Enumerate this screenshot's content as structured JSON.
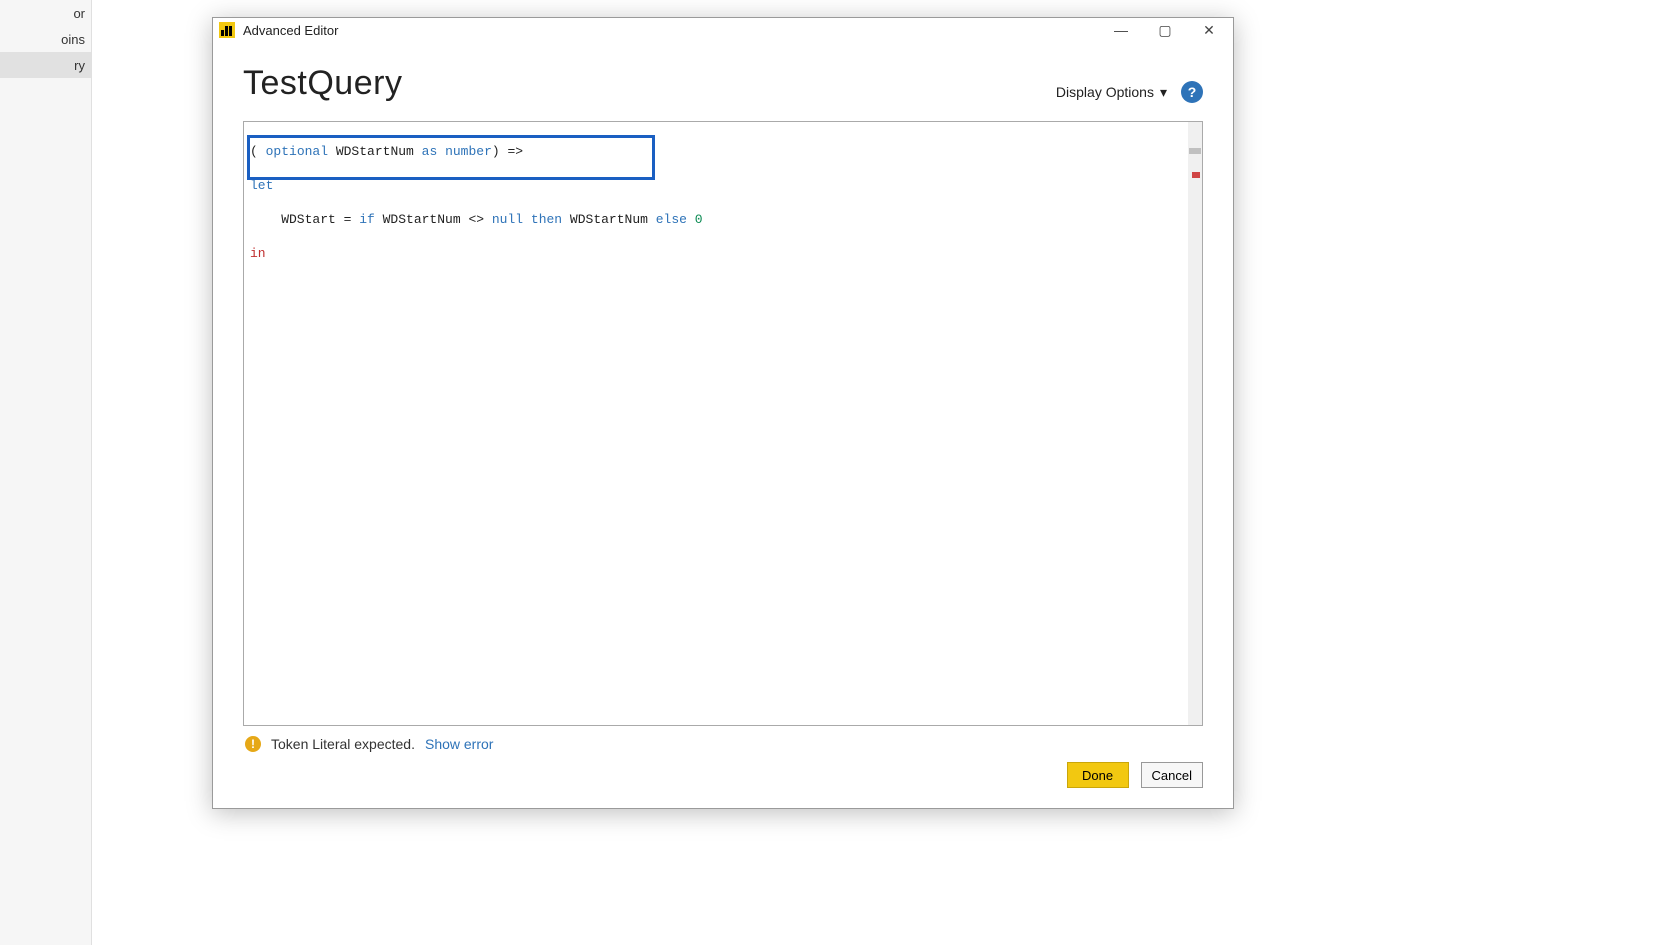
{
  "sidebar": {
    "items": [
      {
        "label": "or"
      },
      {
        "label": "oins"
      },
      {
        "label": "ry"
      }
    ],
    "selected_index": 2
  },
  "window": {
    "title": "Advanced Editor"
  },
  "page": {
    "query_name": "TestQuery",
    "display_options_label": "Display Options"
  },
  "code": {
    "line1_pre": "( ",
    "line1_kw1": "optional",
    "line1_mid": " WDStartNum ",
    "line1_kw2": "as",
    "line1_sp": " ",
    "line1_kw3": "number",
    "line1_post": ") =>",
    "line2_kw": "let",
    "line3_pre": "    WDStart = ",
    "line3_kw1": "if",
    "line3_mid1": " WDStartNum <> ",
    "line3_kw2": "null",
    "line3_sp1": " ",
    "line3_kw3": "then",
    "line3_mid2": " WDStartNum ",
    "line3_kw4": "else",
    "line3_sp2": " ",
    "line3_num": "0",
    "line4_kw": "in"
  },
  "status": {
    "message": "Token Literal expected.",
    "link": "Show error"
  },
  "buttons": {
    "done": "Done",
    "cancel": "Cancel"
  }
}
